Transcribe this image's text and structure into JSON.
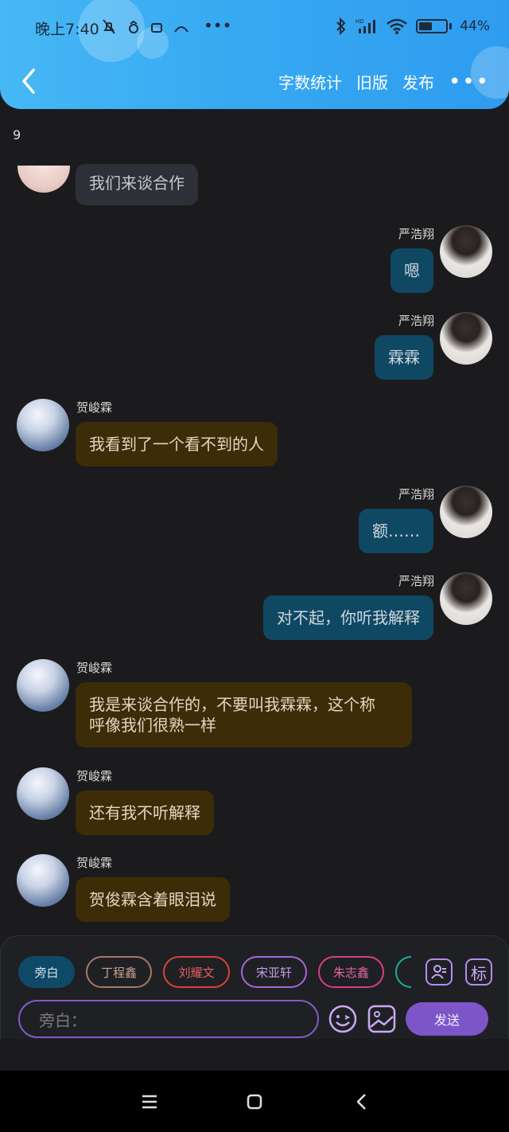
{
  "status_bar": {
    "time": "晚上7:40",
    "battery": "44%",
    "battery_level": 0.44
  },
  "nav": {
    "word_count": "字数统计",
    "old_version": "旧版",
    "publish": "发布"
  },
  "counter": "9",
  "messages": [
    {
      "side": "left",
      "name": "",
      "text": "我们来谈合作"
    },
    {
      "side": "right",
      "name": "严浩翔",
      "text": "嗯"
    },
    {
      "side": "right",
      "name": "严浩翔",
      "text": "霖霖"
    },
    {
      "side": "left",
      "name": "贺峻霖",
      "text": "我看到了一个看不到的人"
    },
    {
      "side": "right",
      "name": "严浩翔",
      "text": "额……"
    },
    {
      "side": "right",
      "name": "严浩翔",
      "text": "对不起，你听我解释"
    },
    {
      "side": "left",
      "name": "贺峻霖",
      "text_line1": "我是来谈合作的，不要叫我霖霖，这个称",
      "text_line2": "呼像我们很熟一样"
    },
    {
      "side": "left",
      "name": "贺峻霖",
      "text": "还有我不听解释"
    },
    {
      "side": "left",
      "name": "贺峻霖",
      "text": "贺俊霖含着眼泪说"
    }
  ],
  "roles": [
    {
      "label": "旁白",
      "color": "#0e4a67"
    },
    {
      "label": "丁程鑫",
      "color": "#a57a63"
    },
    {
      "label": "刘耀文",
      "color": "#d8423f"
    },
    {
      "label": "宋亚轩",
      "color": "#a46ad6"
    },
    {
      "label": "朱志鑫",
      "color": "#d63f83"
    }
  ],
  "tag_icon_label": "标",
  "input": {
    "placeholder": "旁白："
  },
  "send_label": "发送",
  "colors": {
    "accent": "#7d55c9",
    "header": "#37a9f2",
    "bubble_blue": "#0f4863",
    "bubble_brown": "#3c2c08",
    "bubble_gray": "#2d3038"
  }
}
